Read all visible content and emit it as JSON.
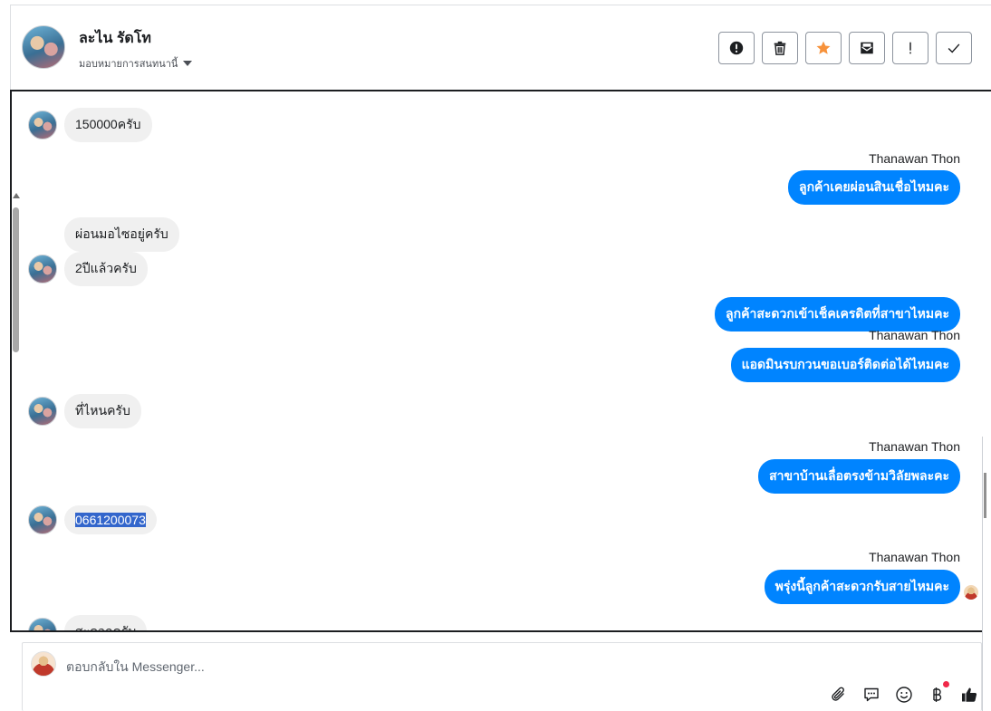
{
  "contact": {
    "name": "ละไน รัดโท",
    "assign_label": "มอบหมายการสนทนานี้"
  },
  "toolbar": [
    {
      "name": "report-spam-button",
      "icon": "alert-circle-icon"
    },
    {
      "name": "delete-button",
      "icon": "trash-icon"
    },
    {
      "name": "star-button",
      "icon": "star-icon",
      "color": "#f7923b"
    },
    {
      "name": "mark-unread-button",
      "icon": "envelope-icon"
    },
    {
      "name": "mark-important-button",
      "icon": "exclamation-icon"
    },
    {
      "name": "mark-done-button",
      "icon": "check-icon"
    }
  ],
  "messages": {
    "m1": "150000ครับ",
    "s1": "Thanawan Thon",
    "m2": "ลูกค้าเคยผ่อนสินเชื่อไหมคะ",
    "m3": "ผ่อนมอไซอยู่ครับ",
    "m4": "2ปีแล้วครับ",
    "m5": "ลูกค้าสะดวกเข้าเช็คเครดิตที่สาขาไหมคะ",
    "s2": "Thanawan Thon",
    "m6": "แอดมินรบกวนขอเบอร์ติดต่อได้ไหมคะ",
    "m7": "ที่ไหนครับ",
    "s3": "Thanawan Thon",
    "m8": "สาขาบ้านเลื่อตรงข้ามวิลัยพละคะ",
    "m9": "0661200073",
    "s4": "Thanawan Thon",
    "m10": "พรุ่งนี้ลูกค้าสะดวกรับสายไหมคะ",
    "m11": "สะดวกครับ"
  },
  "composer": {
    "placeholder": "ตอบกลับใน Messenger..."
  },
  "colors": {
    "outgoing_bubble": "#0084ff",
    "incoming_bubble": "#f0f0f0",
    "selection": "#3366cc"
  }
}
